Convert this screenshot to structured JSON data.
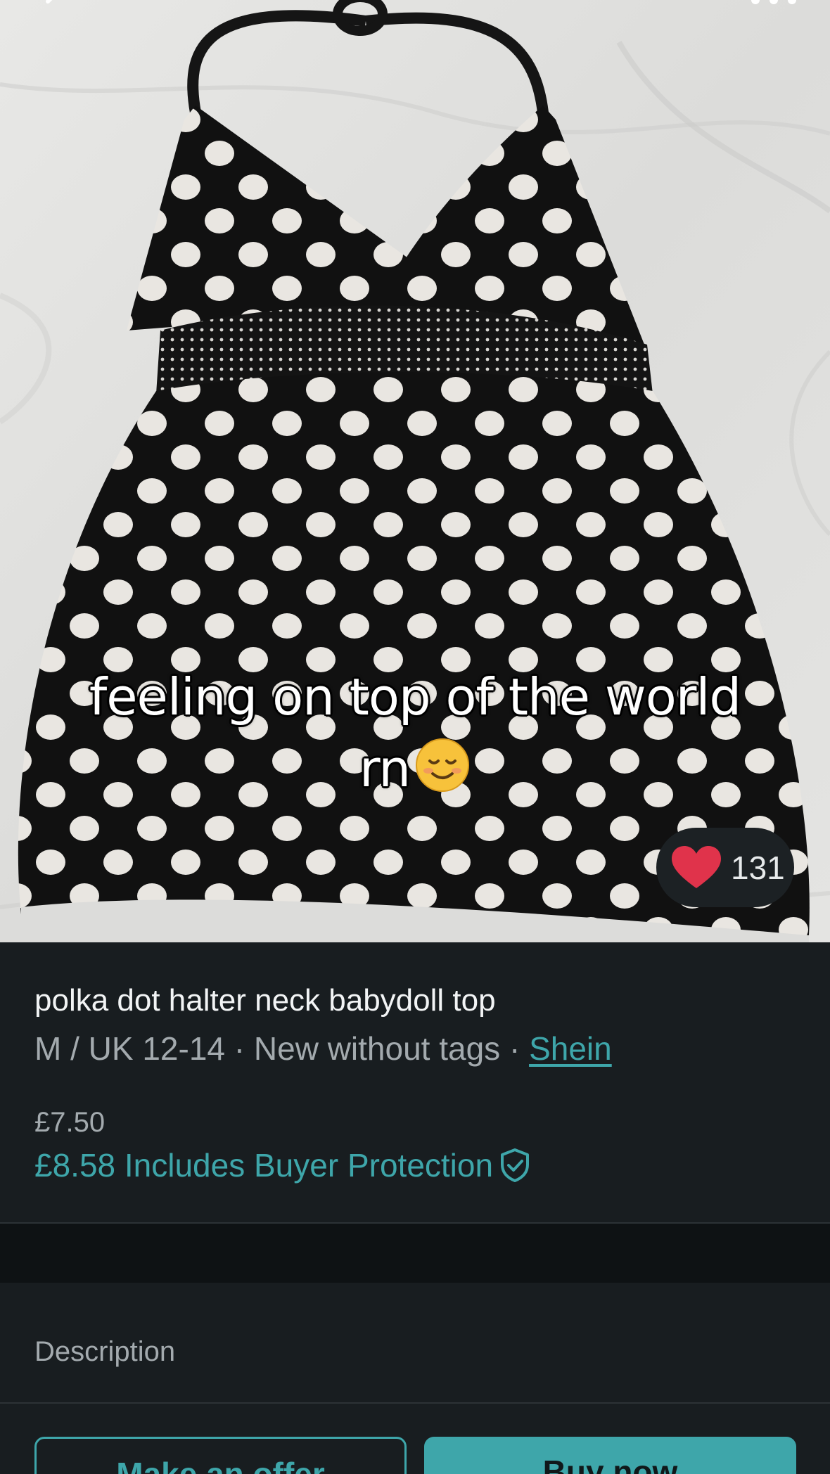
{
  "photo": {
    "caption_lines": [
      "feeling on top of the world",
      "rn"
    ],
    "caption_emoji_icon": "smiling-face-icon"
  },
  "likes": {
    "count": "131",
    "icon": "heart-icon"
  },
  "item": {
    "title": "polka dot halter neck babydoll top",
    "size": "M / UK 12-14",
    "separator": " · ",
    "condition": "New without tags",
    "brand": "Shein",
    "price": "£7.50",
    "total_price": "£8.58 Includes Buyer Protection",
    "protection_icon": "shield-check-icon"
  },
  "description": {
    "label": "Description"
  },
  "actions": {
    "offer_label": "Make an offer",
    "buy_label": "Buy now"
  },
  "colors": {
    "accent": "#3ea6aa",
    "background": "#181d20",
    "heart": "#e0334b"
  }
}
